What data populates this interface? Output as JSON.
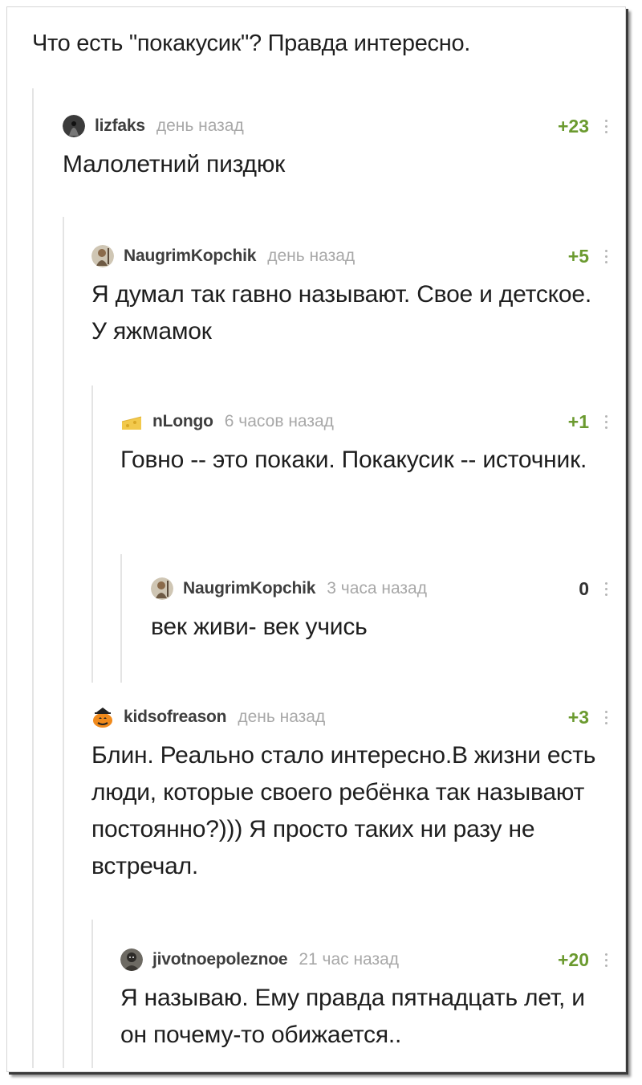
{
  "post": {
    "title": "Что есть \"покакусик\"? Правда интересно."
  },
  "comments": [
    {
      "user": "lizfaks",
      "time": "день назад",
      "rating": "+23",
      "text": "Малолетний пиздюк",
      "avatar": "hooded-figure-avatar"
    },
    {
      "user": "NaugrimKopchik",
      "time": "день назад",
      "rating": "+5",
      "text": "Я думал так гавно называют. Свое и детское. У яжмамок",
      "avatar": "dwarf-avatar"
    },
    {
      "user": "nLongo",
      "time": "6 часов назад",
      "rating": "+1",
      "text": "Говно -- это покаки. Покакусик -- источник.",
      "avatar": "cheese-avatar"
    },
    {
      "user": "NaugrimKopchik",
      "time": "3 часа назад",
      "rating": "0",
      "text": "век живи- век учись",
      "avatar": "dwarf-avatar"
    },
    {
      "user": "kidsofreason",
      "time": "день назад",
      "rating": "+3",
      "text": "Блин. Реально стало интересно.В жизни есть люди, которые своего ребёнка так называют постоянно?))) Я просто таких ни разу не встречал.",
      "avatar": "pumpkin-avatar"
    },
    {
      "user": "jivotnoepoleznoe",
      "time": "21 час назад",
      "rating": "+20",
      "text": "Я называю. Ему правда пятнадцать лет, и он почему-то обижается..",
      "avatar": "masked-person-avatar"
    }
  ],
  "colors": {
    "rating_positive": "#6b9a2f",
    "username": "#3e3e3e",
    "timestamp": "#a8a8a8",
    "thread_line": "#e4e4e4"
  }
}
